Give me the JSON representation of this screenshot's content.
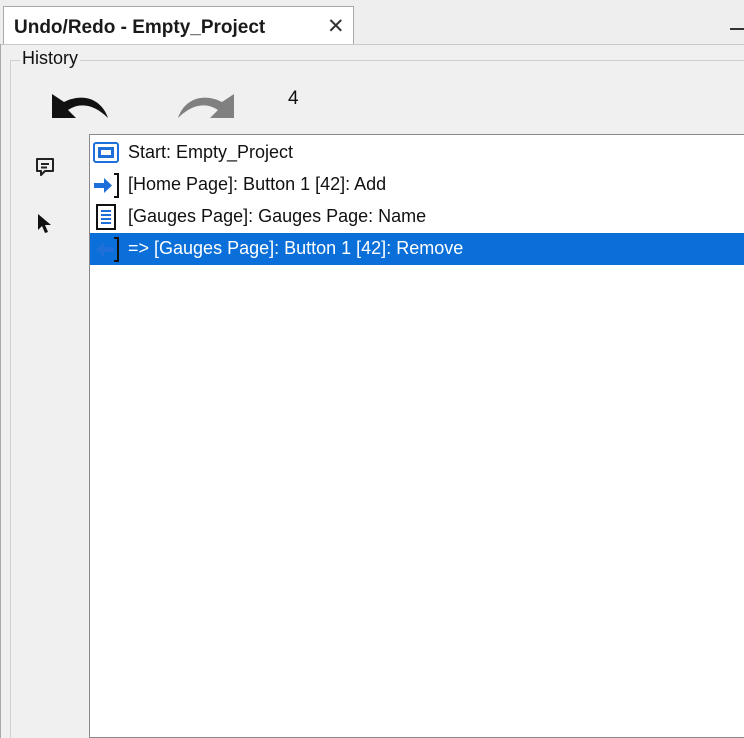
{
  "tab": {
    "title": "Undo/Redo - Empty_Project",
    "close_glyph": "✕"
  },
  "group": {
    "legend": "History"
  },
  "toolbar": {
    "undo_icon": "undo-arrow-icon",
    "redo_icon": "redo-arrow-icon",
    "count": "4"
  },
  "tools": [
    {
      "icon": "comment-icon"
    },
    {
      "icon": "pointer-icon"
    }
  ],
  "history": [
    {
      "icon": "screen-icon",
      "text": "Start: Empty_Project",
      "selected": false
    },
    {
      "icon": "add-arrow-icon",
      "text": "[Home Page]: Button 1 [42]: Add",
      "selected": false
    },
    {
      "icon": "document-icon",
      "text": "[Gauges Page]: Gauges Page: Name",
      "selected": false
    },
    {
      "icon": "remove-arrow-icon",
      "text": "=> [Gauges Page]: Button 1 [42]: Remove",
      "selected": true
    }
  ],
  "colors": {
    "selection": "#0a6fd8",
    "icon_blue": "#1e6fd9"
  }
}
